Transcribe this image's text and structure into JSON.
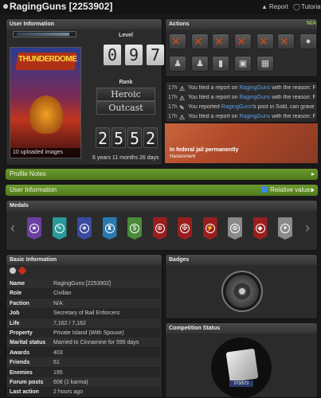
{
  "header": {
    "title": "RagingGuns [2253902]",
    "report_label": "Report",
    "tutorial_label": "Tutorial"
  },
  "user_info": {
    "heading": "User Information",
    "uploaded_images": "10 uploaded images",
    "level_label": "Level",
    "level_digits": [
      "0",
      "9",
      "7"
    ],
    "rank_label": "Rank",
    "rank_line1": "Heroic",
    "rank_line2": "Outcast",
    "age_digits": [
      "2",
      "5",
      "5",
      "2"
    ],
    "age_text": "6 years 11 months 26 days"
  },
  "actions": {
    "heading": "Actions",
    "na_label": "N/A",
    "feed": [
      {
        "time": "17h",
        "icon": "⚠",
        "pre": "You filed a report on ",
        "who": "RagingGuns",
        "post": " with the reason: Foru…"
      },
      {
        "time": "17h",
        "icon": "⚠",
        "pre": "You filed a report on ",
        "who": "RagingGuns",
        "post": " with the reason: Foru…"
      },
      {
        "time": "17h",
        "icon": "✎",
        "pre": "You reported ",
        "who": "RagingGuns",
        "post": "'s post in Sold, can grave in Tr…"
      },
      {
        "time": "17h",
        "icon": "⚠",
        "pre": "You filed a report on ",
        "who": "RagingGuns",
        "post": " with the reason: Fo…"
      }
    ],
    "status_title": "In federal jail permanently",
    "status_sub": "Harassment"
  },
  "bars": {
    "profile_notes": "Profile Notes",
    "user_information": "User Information",
    "relative_values": "Relative values"
  },
  "medals": {
    "heading": "Medals",
    "items": [
      {
        "color": "#6a3fa0",
        "icon": "★"
      },
      {
        "color": "#2a9a9a",
        "icon": "✎"
      },
      {
        "color": "#3a4aa0",
        "icon": "★"
      },
      {
        "color": "#2a7ab0",
        "icon": "♜"
      },
      {
        "color": "#4a8a3a",
        "icon": "$"
      },
      {
        "color": "#9a1e1e",
        "icon": "⊕"
      },
      {
        "color": "#9a1e1e",
        "icon": "✠"
      },
      {
        "color": "#9a1e1e",
        "icon": "⚡"
      },
      {
        "color": "#8a8a8a",
        "icon": "⊕"
      },
      {
        "color": "#9a1e1e",
        "icon": "◆"
      },
      {
        "color": "#8a8a8a",
        "icon": "✦"
      }
    ]
  },
  "basic_info": {
    "heading": "Basic Information",
    "rows": [
      {
        "key": "Name",
        "value": "RagingGuns [2253902]"
      },
      {
        "key": "Role",
        "value": "Civilian"
      },
      {
        "key": "Faction",
        "value": "N/A"
      },
      {
        "key": "Job",
        "value": "Secretary of Bail Enforcers"
      },
      {
        "key": "Life",
        "value": "7,162 / 7,162"
      },
      {
        "key": "Property",
        "value": "Private Island (With Spouse)"
      },
      {
        "key": "Marital status",
        "value": "Married to Cinnamine for 595 days"
      },
      {
        "key": "Awards",
        "value": "403"
      },
      {
        "key": "Friends",
        "value": "61"
      },
      {
        "key": "Enemies",
        "value": "195"
      },
      {
        "key": "Forum posts",
        "value": "608 (1 karma)"
      },
      {
        "key": "Last action",
        "value": "2 hours ago"
      }
    ]
  },
  "badges": {
    "heading": "Badges"
  },
  "competition": {
    "heading": "Competition Status",
    "score": "573/573"
  }
}
